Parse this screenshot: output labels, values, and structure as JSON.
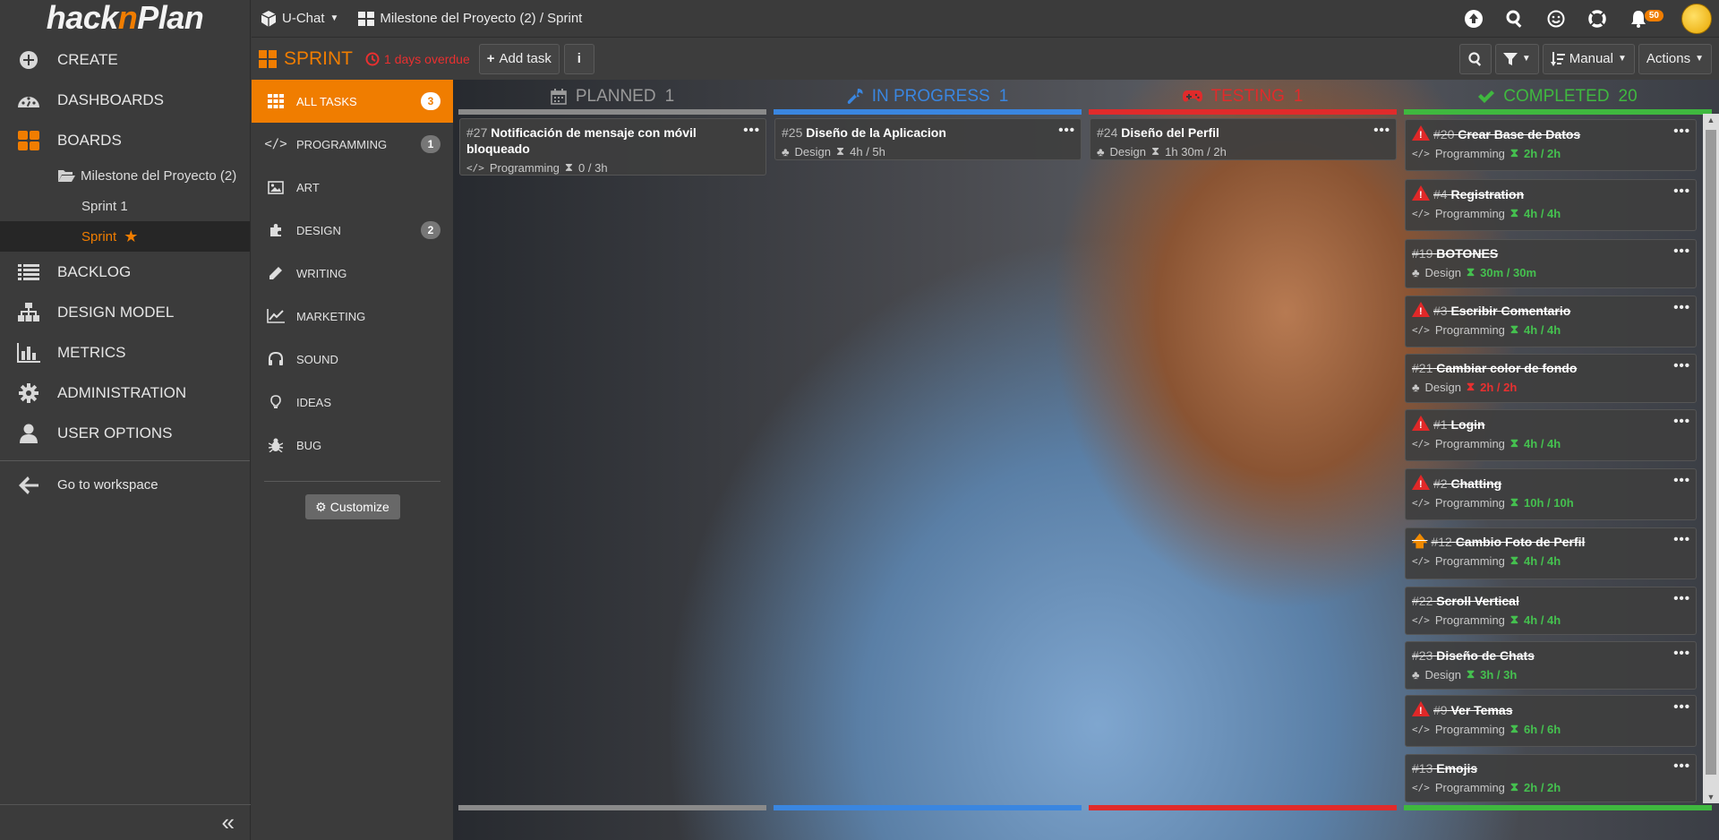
{
  "app": {
    "logo_a": "hack",
    "logo_n": "n",
    "logo_b": "Plan"
  },
  "sidebar": {
    "items": [
      {
        "label": "CREATE"
      },
      {
        "label": "DASHBOARDS"
      },
      {
        "label": "BOARDS"
      },
      {
        "label": "BACKLOG"
      },
      {
        "label": "DESIGN MODEL"
      },
      {
        "label": "METRICS"
      },
      {
        "label": "ADMINISTRATION"
      },
      {
        "label": "USER OPTIONS"
      }
    ],
    "milestone": "Milestone del Proyecto (2)",
    "sprint1": "Sprint 1",
    "sprint_current": "Sprint",
    "goto": "Go to workspace",
    "collapse": "«"
  },
  "topbar": {
    "project": "U-Chat",
    "breadcrumb": "Milestone del Proyecto (2) / Sprint",
    "notif_count": "50"
  },
  "sprintbar": {
    "title": "SPRINT",
    "overdue": "1 days overdue",
    "add_task": "Add task",
    "info": "i",
    "sort": "Manual",
    "actions": "Actions"
  },
  "categories": [
    {
      "label": "ALL TASKS",
      "count": "3"
    },
    {
      "label": "PROGRAMMING",
      "count": "1"
    },
    {
      "label": "ART",
      "count": ""
    },
    {
      "label": "DESIGN",
      "count": "2"
    },
    {
      "label": "WRITING",
      "count": ""
    },
    {
      "label": "MARKETING",
      "count": ""
    },
    {
      "label": "SOUND",
      "count": ""
    },
    {
      "label": "IDEAS",
      "count": ""
    },
    {
      "label": "BUG",
      "count": ""
    }
  ],
  "customize": "Customize",
  "columns": {
    "planned": {
      "label": "PLANNED",
      "count": "1",
      "color": "#8a8a8a"
    },
    "inprogress": {
      "label": "IN PROGRESS",
      "count": "1",
      "color": "#3a86e0"
    },
    "testing": {
      "label": "TESTING",
      "count": "1",
      "color": "#e02b2b"
    },
    "completed": {
      "label": "COMPLETED",
      "count": "20",
      "color": "#3fb83f"
    }
  },
  "cards": {
    "planned": [
      {
        "id": "#27",
        "title": "Notificación de mensaje con móvil bloqueado",
        "category": "Programming",
        "estimate": "0 / 3h"
      }
    ],
    "inprogress": [
      {
        "id": "#25",
        "title": "Diseño de la Aplicacion",
        "category": "Design",
        "estimate": "4h / 5h"
      }
    ],
    "testing": [
      {
        "id": "#24",
        "title": "Diseño del Perfil",
        "category": "Design",
        "estimate": "1h 30m / 2h"
      }
    ],
    "completed": [
      {
        "id": "#20",
        "title": "Crear Base de Datos",
        "category": "Programming",
        "estimate": "2h / 2h"
      },
      {
        "id": "#4",
        "title": "Registration",
        "category": "Programming",
        "estimate": "4h / 4h"
      },
      {
        "id": "#19",
        "title": "BOTONES",
        "category": "Design",
        "estimate": "30m / 30m"
      },
      {
        "id": "#3",
        "title": "Escribir Comentario",
        "category": "Programming",
        "estimate": "4h / 4h"
      },
      {
        "id": "#21",
        "title": "Cambiar color de fondo",
        "category": "Design",
        "estimate": "2h / 2h"
      },
      {
        "id": "#1",
        "title": "Login",
        "category": "Programming",
        "estimate": "4h / 4h"
      },
      {
        "id": "#2",
        "title": "Chatting",
        "category": "Programming",
        "estimate": "10h / 10h"
      },
      {
        "id": "#12",
        "title": "Cambio Foto de Perfil",
        "category": "Programming",
        "estimate": "4h / 4h"
      },
      {
        "id": "#22",
        "title": "Scroll Vertical",
        "category": "Programming",
        "estimate": "4h / 4h"
      },
      {
        "id": "#23",
        "title": "Diseño de Chats",
        "category": "Design",
        "estimate": "3h / 3h"
      },
      {
        "id": "#9",
        "title": "Ver Temas",
        "category": "Programming",
        "estimate": "6h / 6h"
      },
      {
        "id": "#13",
        "title": "Emojis",
        "category": "Programming",
        "estimate": "2h / 2h"
      }
    ]
  }
}
